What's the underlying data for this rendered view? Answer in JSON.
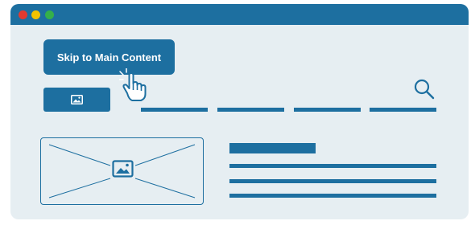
{
  "window": {
    "accent_color": "#1d6fa0",
    "background_color": "#e6eef2"
  },
  "title_bar": {
    "traffic_lights": [
      {
        "name": "close",
        "color": "#e23a30"
      },
      {
        "name": "minimize",
        "color": "#f2c200"
      },
      {
        "name": "maximize",
        "color": "#35b04a"
      }
    ]
  },
  "skip_link": {
    "label": "Skip to Main Content"
  },
  "header": {
    "logo_icon": "image-icon",
    "search_icon": "search-icon",
    "nav_items_count": 4
  },
  "main": {
    "hero_image_icon": "image-icon",
    "text_lines_count": 3
  },
  "cursor_icon": "pointer-hand-icon"
}
